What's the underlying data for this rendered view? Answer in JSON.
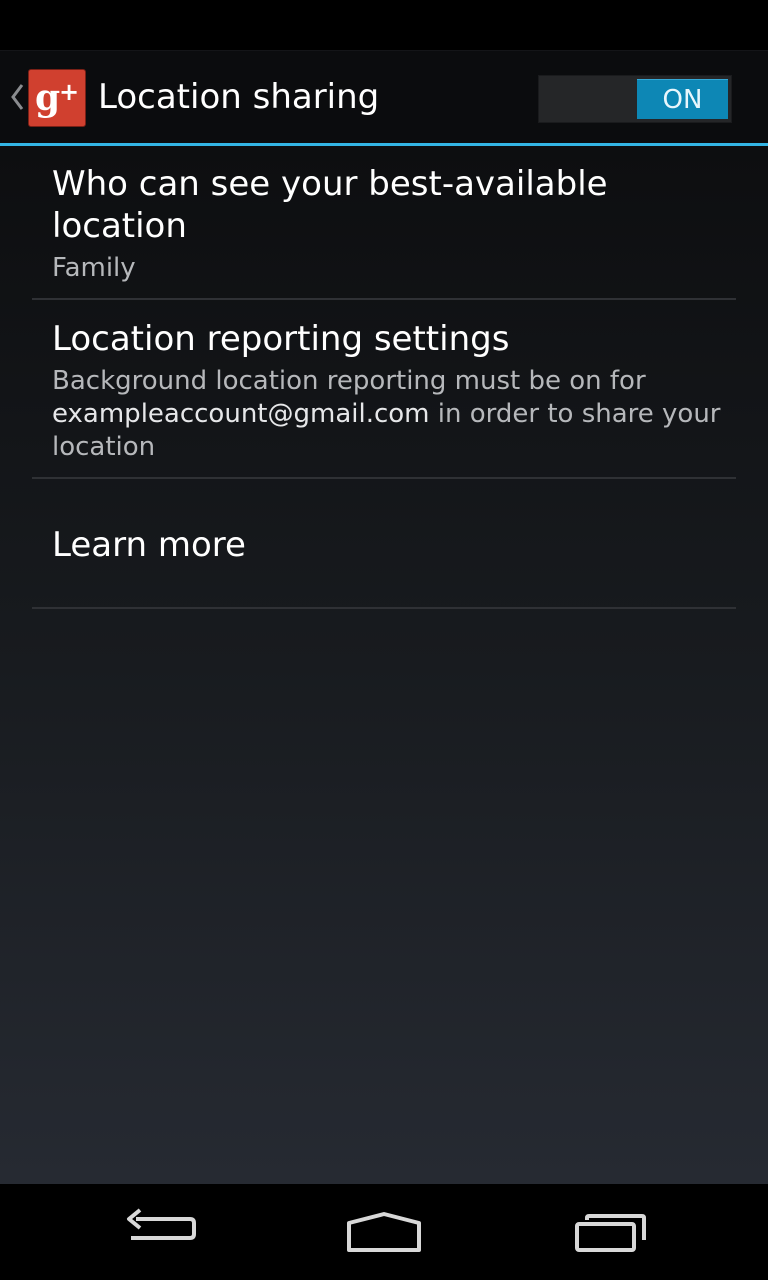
{
  "action_bar": {
    "title": "Location sharing",
    "toggle_label": "ON",
    "app_icon": "google-plus-icon",
    "up_icon": "chevron-left-icon"
  },
  "preferences": [
    {
      "title": "Who can see your best-available location",
      "summary": "Family"
    },
    {
      "title": "Location reporting settings",
      "summary_before": "Background location reporting must be on for",
      "summary_email": "exampleaccount@gmail.com",
      "summary_after": " in order to share your location"
    },
    {
      "title": "Learn more"
    }
  ],
  "nav": {
    "back_icon": "back-arrow-icon",
    "home_icon": "home-icon",
    "recents_icon": "recent-apps-icon"
  },
  "colors": {
    "accent": "#33b5e5",
    "toggle_on": "#0d87b5",
    "brand_red": "#d0402f"
  }
}
